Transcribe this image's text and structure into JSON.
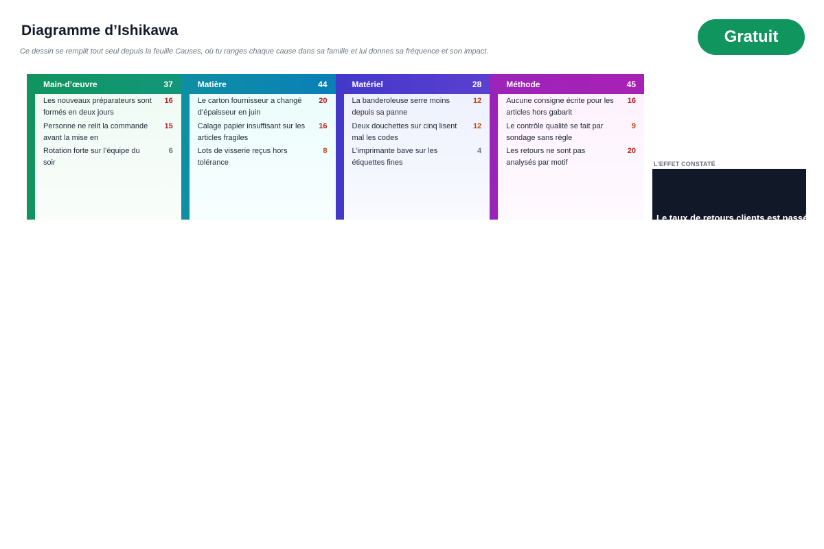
{
  "header": {
    "title": "Diagramme d’Ishikawa",
    "subtitle": "Ce dessin se remplit tout seul depuis la feuille Causes, où tu ranges chaque cause dans sa famille et lui donnes sa fréquence et son impact.",
    "badge": "Gratuit"
  },
  "colors": {
    "badge": "#10955f",
    "effect_bg": "#111827",
    "score_high": "#b91c1c",
    "score_mid": "#c2410c",
    "score_low": "#6b7280"
  },
  "families": [
    {
      "name": "Main-d’œuvre",
      "total": "37",
      "color_start": "#10955f",
      "color_end": "#12967a",
      "body_bg": "#effbf4",
      "causes": [
        {
          "text": "Les nouveaux préparateurs sont formés en deux jours",
          "score": "16"
        },
        {
          "text": "Personne ne relit la commande avant la mise en",
          "score": "15"
        },
        {
          "text": "Rotation forte sur l’équipe du soir",
          "score": "6"
        }
      ]
    },
    {
      "name": "Matière",
      "total": "44",
      "color_start": "#0e8fa3",
      "color_end": "#0a7fb8",
      "body_bg": "#ebfdfc",
      "causes": [
        {
          "text": "Le carton fournisseur a changé d’épaisseur en juin",
          "score": "20"
        },
        {
          "text": "Calage papier insuffisant sur les articles fragiles",
          "score": "16"
        },
        {
          "text": "Lots de visserie reçus hors tolérance",
          "score": "8"
        }
      ]
    },
    {
      "name": "Matériel",
      "total": "28",
      "color_start": "#4338ca",
      "color_end": "#5b3fd0",
      "body_bg": "#eef1fd",
      "causes": [
        {
          "text": "La banderoleuse serre moins depuis sa panne",
          "score": "12"
        },
        {
          "text": "Deux douchettes sur cinq lisent mal les codes",
          "score": "12"
        },
        {
          "text": "L’imprimante bave sur les étiquettes fines",
          "score": "4"
        }
      ]
    },
    {
      "name": "Méthode",
      "total": "45",
      "color_start": "#9b24b8",
      "color_end": "#a821b5",
      "body_bg": "#fdf2fd",
      "causes": [
        {
          "text": "Aucune consigne écrite pour les articles hors gabarit",
          "score": "16"
        },
        {
          "text": "Le contrôle qualité se fait par sondage sans règle",
          "score": "9"
        },
        {
          "text": "Les retours ne sont pas analysés par motif",
          "score": "20"
        }
      ]
    }
  ],
  "effect": {
    "label": "L’EFFET CONSTATÉ",
    "text": "Le taux de retours clients est passé"
  }
}
